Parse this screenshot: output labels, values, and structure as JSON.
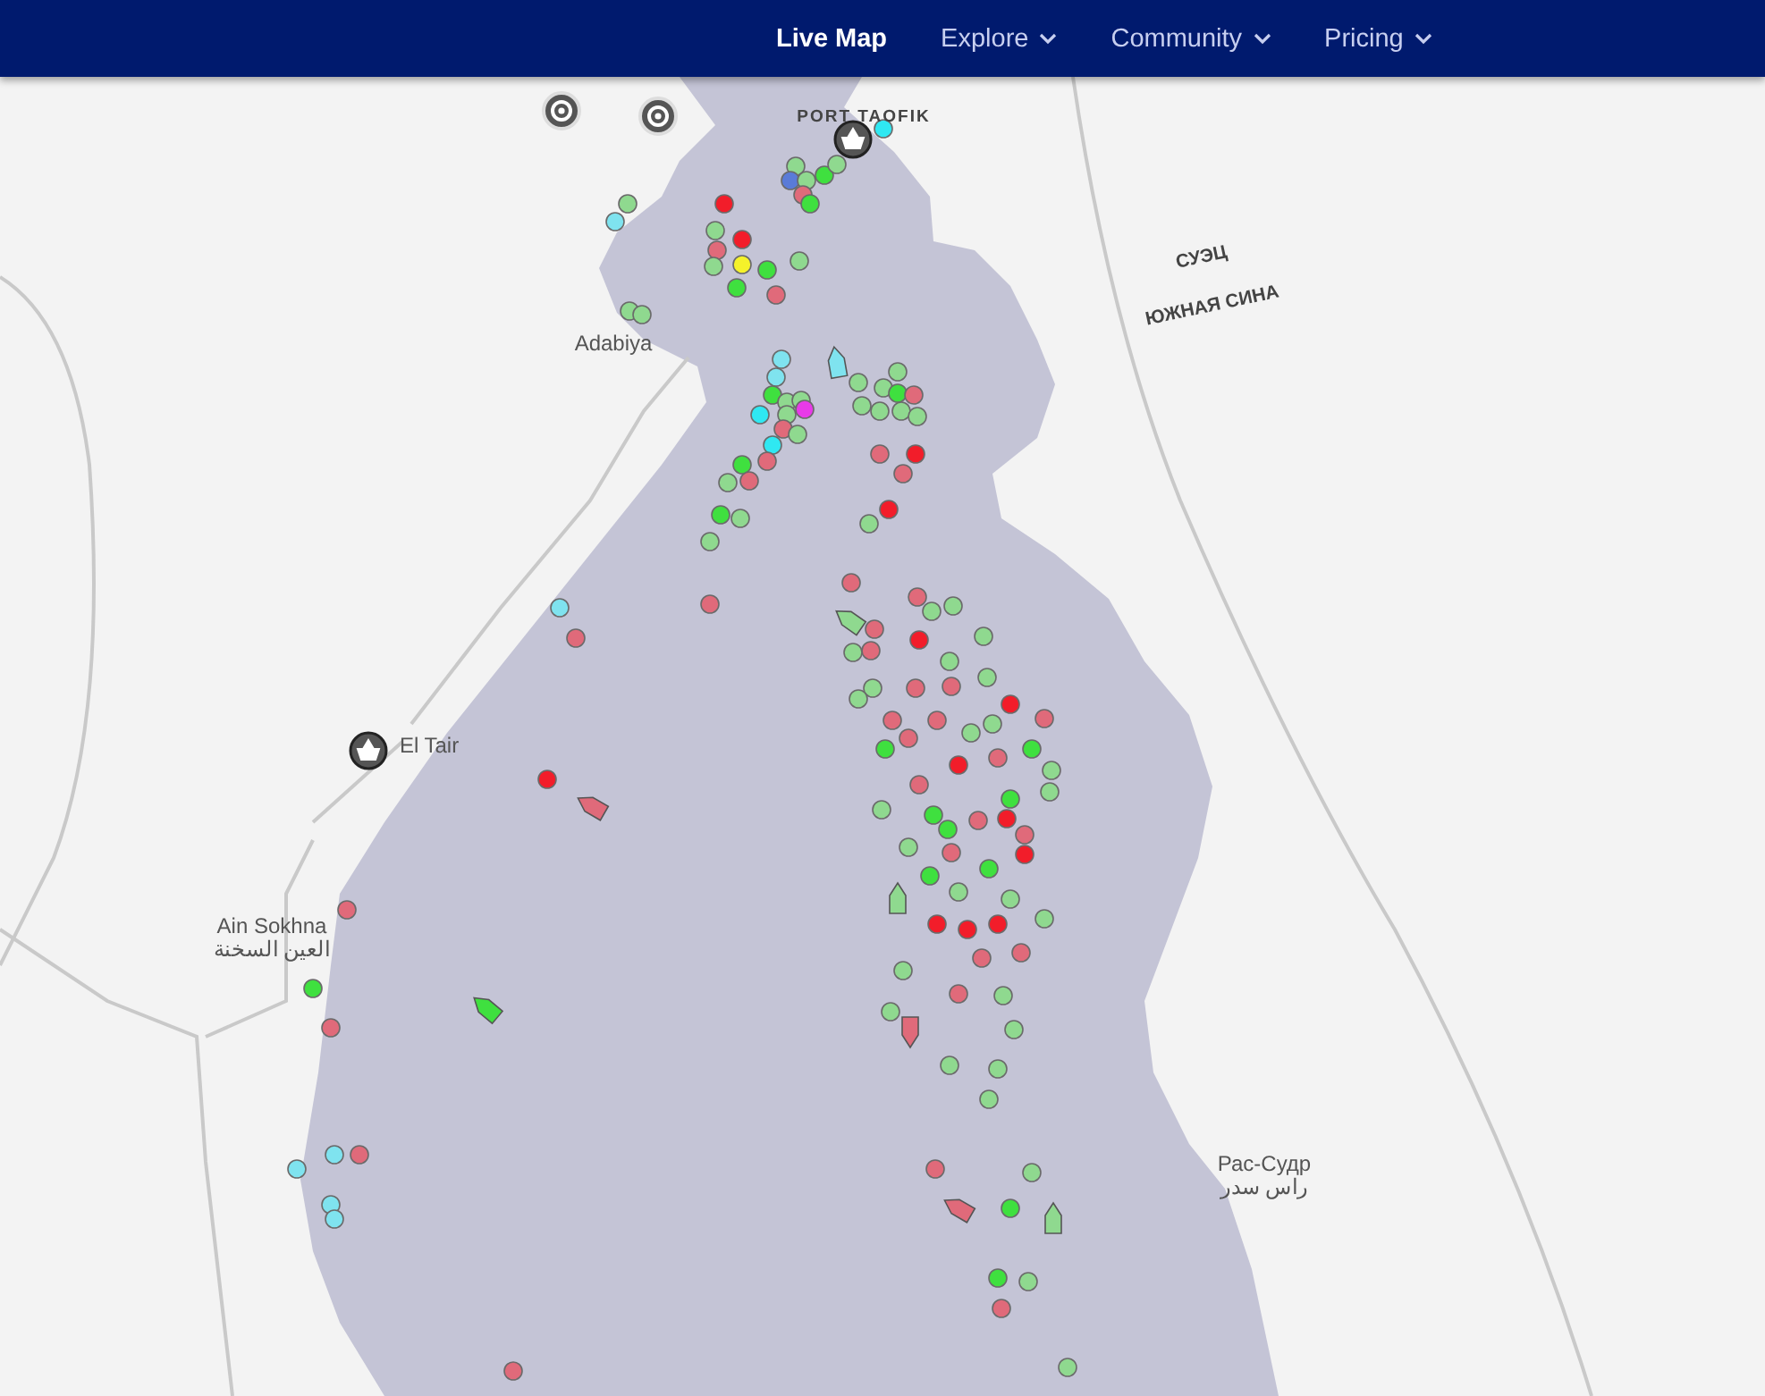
{
  "nav": {
    "items": [
      {
        "label": "Live Map",
        "selected": true,
        "dropdown": false
      },
      {
        "label": "Explore",
        "selected": false,
        "dropdown": true
      },
      {
        "label": "Community",
        "selected": false,
        "dropdown": true
      },
      {
        "label": "Pricing",
        "selected": false,
        "dropdown": true
      }
    ]
  },
  "map": {
    "place_labels": [
      {
        "kind": "port",
        "lines": [
          "PORT TAOFIK"
        ]
      },
      {
        "kind": "town",
        "lines": [
          "Adabiya"
        ]
      },
      {
        "kind": "region",
        "lines": [
          "СУЭЦ"
        ]
      },
      {
        "kind": "region",
        "lines": [
          "ЮЖНАЯ СИНА"
        ]
      },
      {
        "kind": "town",
        "lines": [
          "El Tair"
        ]
      },
      {
        "kind": "town",
        "lines": [
          "Ain Sokhna",
          "العين السخنة"
        ]
      },
      {
        "kind": "town",
        "lines": [
          "Рас-Судр",
          "راس سدر"
        ]
      }
    ],
    "vessels": [
      {
        "kind": "dot",
        "color": "#8fd98f"
      },
      {
        "kind": "dot",
        "color": "#7fe3ef"
      },
      {
        "kind": "dot",
        "color": "#f21d2a"
      },
      {
        "kind": "dot",
        "color": "#8fd98f"
      },
      {
        "kind": "dot",
        "color": "#f21d2a"
      },
      {
        "kind": "dot",
        "color": "#e06a7a"
      },
      {
        "kind": "dot",
        "color": "#8fd98f"
      },
      {
        "kind": "dot",
        "color": "#f5f22a"
      },
      {
        "kind": "dot",
        "color": "#3fe03f"
      },
      {
        "kind": "dot",
        "color": "#8fd98f"
      },
      {
        "kind": "dot",
        "color": "#3fe03f"
      },
      {
        "kind": "dot",
        "color": "#e06a7a"
      },
      {
        "kind": "dot",
        "color": "#8fd98f"
      },
      {
        "kind": "dot",
        "color": "#5a7bd8"
      },
      {
        "kind": "dot",
        "color": "#8fd98f"
      },
      {
        "kind": "dot",
        "color": "#3fe03f"
      },
      {
        "kind": "dot",
        "color": "#e06a7a"
      },
      {
        "kind": "dot",
        "color": "#3fe03f"
      },
      {
        "kind": "dot",
        "color": "#8fd98f"
      },
      {
        "kind": "dot",
        "color": "#2fe8f2"
      },
      {
        "kind": "dot",
        "color": "#8fd98f"
      },
      {
        "kind": "dot",
        "color": "#8fd98f"
      },
      {
        "kind": "dot",
        "color": "#7fe3ef"
      },
      {
        "kind": "dot",
        "color": "#7fe3ef"
      },
      {
        "kind": "dot",
        "color": "#3fe03f"
      },
      {
        "kind": "dot",
        "color": "#8fd98f"
      },
      {
        "kind": "dot",
        "color": "#8fd98f"
      },
      {
        "kind": "dot",
        "color": "#e83ae8"
      },
      {
        "kind": "dot",
        "color": "#2fe8f2"
      },
      {
        "kind": "dot",
        "color": "#8fd98f"
      },
      {
        "kind": "dot",
        "color": "#e06a7a"
      },
      {
        "kind": "dot",
        "color": "#8fd98f"
      },
      {
        "kind": "dot",
        "color": "#2fe8f2"
      },
      {
        "kind": "dot",
        "color": "#e06a7a"
      },
      {
        "kind": "dot",
        "color": "#3fe03f"
      },
      {
        "kind": "dot",
        "color": "#e06a7a"
      },
      {
        "kind": "dot",
        "color": "#8fd98f"
      },
      {
        "kind": "dot",
        "color": "#3fe03f"
      },
      {
        "kind": "dot",
        "color": "#8fd98f"
      },
      {
        "kind": "dot",
        "color": "#8fd98f"
      },
      {
        "kind": "dot",
        "color": "#8fd98f"
      },
      {
        "kind": "dot",
        "color": "#8fd98f"
      },
      {
        "kind": "dot",
        "color": "#8fd98f"
      },
      {
        "kind": "dot",
        "color": "#3fe03f"
      },
      {
        "kind": "dot",
        "color": "#e06a7a"
      },
      {
        "kind": "dot",
        "color": "#8fd98f"
      },
      {
        "kind": "dot",
        "color": "#8fd98f"
      },
      {
        "kind": "dot",
        "color": "#8fd98f"
      },
      {
        "kind": "dot",
        "color": "#8fd98f"
      },
      {
        "kind": "dot",
        "color": "#e06a7a"
      },
      {
        "kind": "dot",
        "color": "#f21d2a"
      },
      {
        "kind": "dot",
        "color": "#e06a7a"
      },
      {
        "kind": "dot",
        "color": "#f21d2a"
      },
      {
        "kind": "dot",
        "color": "#8fd98f"
      },
      {
        "kind": "dot",
        "color": "#e06a7a"
      },
      {
        "kind": "dot",
        "color": "#e06a7a"
      },
      {
        "kind": "dot",
        "color": "#8fd98f"
      },
      {
        "kind": "dot",
        "color": "#8fd98f"
      },
      {
        "kind": "dot",
        "color": "#e06a7a"
      },
      {
        "kind": "dot",
        "color": "#f21d2a"
      },
      {
        "kind": "dot",
        "color": "#8fd98f"
      },
      {
        "kind": "dot",
        "color": "#e06a7a"
      },
      {
        "kind": "dot",
        "color": "#8fd98f"
      },
      {
        "kind": "dot",
        "color": "#8fd98f"
      },
      {
        "kind": "dot",
        "color": "#8fd98f"
      },
      {
        "kind": "dot",
        "color": "#e06a7a"
      },
      {
        "kind": "dot",
        "color": "#e06a7a"
      },
      {
        "kind": "dot",
        "color": "#8fd98f"
      },
      {
        "kind": "dot",
        "color": "#8fd98f"
      },
      {
        "kind": "dot",
        "color": "#f21d2a"
      },
      {
        "kind": "dot",
        "color": "#e06a7a"
      },
      {
        "kind": "dot",
        "color": "#e06a7a"
      },
      {
        "kind": "dot",
        "color": "#e06a7a"
      },
      {
        "kind": "dot",
        "color": "#e06a7a"
      },
      {
        "kind": "dot",
        "color": "#8fd98f"
      },
      {
        "kind": "dot",
        "color": "#8fd98f"
      },
      {
        "kind": "dot",
        "color": "#3fe03f"
      },
      {
        "kind": "dot",
        "color": "#f21d2a"
      },
      {
        "kind": "dot",
        "color": "#e06a7a"
      },
      {
        "kind": "dot",
        "color": "#3fe03f"
      },
      {
        "kind": "dot",
        "color": "#8fd98f"
      },
      {
        "kind": "dot",
        "color": "#e06a7a"
      },
      {
        "kind": "dot",
        "color": "#8fd98f"
      },
      {
        "kind": "dot",
        "color": "#3fe03f"
      },
      {
        "kind": "dot",
        "color": "#8fd98f"
      },
      {
        "kind": "dot",
        "color": "#3fe03f"
      },
      {
        "kind": "dot",
        "color": "#3fe03f"
      },
      {
        "kind": "dot",
        "color": "#e06a7a"
      },
      {
        "kind": "dot",
        "color": "#f21d2a"
      },
      {
        "kind": "dot",
        "color": "#e06a7a"
      },
      {
        "kind": "dot",
        "color": "#8fd98f"
      },
      {
        "kind": "dot",
        "color": "#e06a7a"
      },
      {
        "kind": "dot",
        "color": "#f21d2a"
      },
      {
        "kind": "dot",
        "color": "#3fe03f"
      },
      {
        "kind": "dot",
        "color": "#3fe03f"
      },
      {
        "kind": "dot",
        "color": "#8fd98f"
      },
      {
        "kind": "dot",
        "color": "#8fd98f"
      },
      {
        "kind": "dot",
        "color": "#8fd98f"
      },
      {
        "kind": "dot",
        "color": "#f21d2a"
      },
      {
        "kind": "dot",
        "color": "#f21d2a"
      },
      {
        "kind": "dot",
        "color": "#f21d2a"
      },
      {
        "kind": "dot",
        "color": "#e06a7a"
      },
      {
        "kind": "dot",
        "color": "#e06a7a"
      },
      {
        "kind": "dot",
        "color": "#8fd98f"
      },
      {
        "kind": "dot",
        "color": "#e06a7a"
      },
      {
        "kind": "dot",
        "color": "#8fd98f"
      },
      {
        "kind": "dot",
        "color": "#8fd98f"
      },
      {
        "kind": "dot",
        "color": "#8fd98f"
      },
      {
        "kind": "dot",
        "color": "#8fd98f"
      },
      {
        "kind": "dot",
        "color": "#8fd98f"
      },
      {
        "kind": "dot",
        "color": "#8fd98f"
      },
      {
        "kind": "dot",
        "color": "#e06a7a"
      },
      {
        "kind": "dot",
        "color": "#8fd98f"
      },
      {
        "kind": "dot",
        "color": "#3fe03f"
      },
      {
        "kind": "dot",
        "color": "#3fe03f"
      },
      {
        "kind": "dot",
        "color": "#8fd98f"
      },
      {
        "kind": "dot",
        "color": "#e06a7a"
      },
      {
        "kind": "dot",
        "color": "#8fd98f"
      },
      {
        "kind": "dot",
        "color": "#e06a7a"
      },
      {
        "kind": "dot",
        "color": "#7fe3ef"
      },
      {
        "kind": "dot",
        "color": "#e06a7a"
      },
      {
        "kind": "dot",
        "color": "#e06a7a"
      },
      {
        "kind": "dot",
        "color": "#f21d2a"
      },
      {
        "kind": "dot",
        "color": "#e06a7a"
      },
      {
        "kind": "dot",
        "color": "#3fe03f"
      },
      {
        "kind": "dot",
        "color": "#e06a7a"
      },
      {
        "kind": "dot",
        "color": "#7fe3ef"
      },
      {
        "kind": "dot",
        "color": "#e06a7a"
      },
      {
        "kind": "dot",
        "color": "#7fe3ef"
      },
      {
        "kind": "dot",
        "color": "#7fe3ef"
      },
      {
        "kind": "dot",
        "color": "#7fe3ef"
      },
      {
        "kind": "ship",
        "color": "#7fe3ef"
      },
      {
        "kind": "ship",
        "color": "#8fd98f"
      },
      {
        "kind": "ship",
        "color": "#e06a7a"
      },
      {
        "kind": "ship",
        "color": "#3fe03f"
      },
      {
        "kind": "ship",
        "color": "#8fd98f"
      },
      {
        "kind": "ship",
        "color": "#e06a7a"
      },
      {
        "kind": "ship",
        "color": "#e06a7a"
      },
      {
        "kind": "ship",
        "color": "#8fd98f"
      }
    ]
  }
}
